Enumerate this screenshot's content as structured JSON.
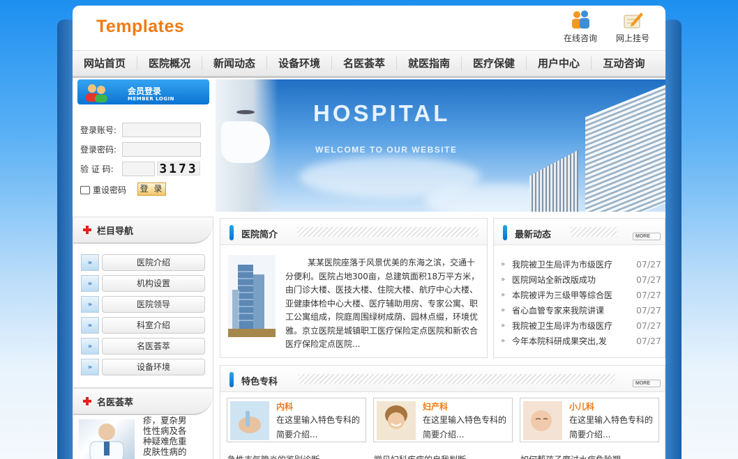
{
  "header": {
    "logo_text": "Templates",
    "quick_links": [
      {
        "label": "在线咨询",
        "icon": "people-icon"
      },
      {
        "label": "网上挂号",
        "icon": "pen-icon"
      }
    ]
  },
  "nav": {
    "items": [
      "网站首页",
      "医院概况",
      "新闻动态",
      "设备环境",
      "名医荟萃",
      "就医指南",
      "医疗保健",
      "用户中心",
      "互动咨询"
    ]
  },
  "login": {
    "title": "会员登录",
    "subtitle": "MEMBER LOGIN",
    "account_label": "登录账号:",
    "password_label": "登录密码:",
    "code_label": "验 证 码:",
    "account_value": "",
    "password_value": "",
    "code_value": "",
    "captcha_text": "3173",
    "reset_label": "重设密码",
    "submit_label": "登 录"
  },
  "banner": {
    "title": "HOSPITAL",
    "subtitle": "WELCOME TO OUR WEBSITE"
  },
  "side_nav": {
    "title": "栏目导航",
    "items": [
      "医院介绍",
      "机构设置",
      "医院领导",
      "科室介绍",
      "名医荟萃",
      "设备环境"
    ]
  },
  "doctors": {
    "title": "名医荟萃",
    "text": "疹，夏杂男性性病及各种疑难危重皮肤性病的"
  },
  "intro": {
    "title": "医院简介",
    "text": "某某医院座落于风景优美的东海之滨，交通十分便利。医院占地300亩，总建筑面积18万平方米，由门诊大楼、医技大楼、住院大楼、航疗中心大楼、亚健康体检中心大楼、医疗辅助用房、专家公寓、职工公寓组成，院庭周围绿树成荫、园林点缀，环境优雅。京立医院是城镇职工医疗保险定点医院和新农合医疗保险定点医院..."
  },
  "news": {
    "title": "最新动态",
    "more_label": "MORE",
    "items": [
      {
        "title": "我院被卫生局评为市级医疗",
        "date": "07/27"
      },
      {
        "title": "医院网站全新改版成功",
        "date": "07/27"
      },
      {
        "title": "本院被评为三级甲等综合医",
        "date": "07/27"
      },
      {
        "title": "省心血管专家来我院讲课",
        "date": "07/27"
      },
      {
        "title": "我院被卫生局评为市级医疗",
        "date": "07/27"
      },
      {
        "title": "今年本院科研成果突出,发",
        "date": "07/27"
      }
    ]
  },
  "specialties": {
    "title": "特色专科",
    "more_label": "MORE",
    "items": [
      {
        "name": "内科",
        "desc": "在这里输入特色专科的简要介绍..."
      },
      {
        "name": "妇产科",
        "desc": "在这里输入特色专科的简要介绍..."
      },
      {
        "name": "小儿科",
        "desc": "在这里输入特色专科的简要介绍..."
      }
    ],
    "links": [
      "急性支气管炎的鉴别诊断",
      "常见妇科疾病的自我判断",
      "如何帮孩子度过水痘危险期"
    ]
  }
}
